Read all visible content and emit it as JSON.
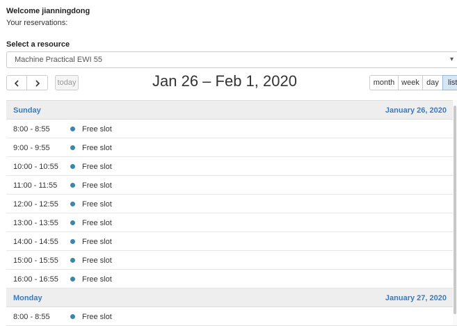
{
  "header": {
    "welcome": "Welcome jianningdong",
    "reservations_label": "Your reservations:"
  },
  "resource": {
    "label": "Select a resource",
    "selected": "Machine Practical EWI 55",
    "caret_icon": "chevron-down-icon"
  },
  "toolbar": {
    "prev_icon": "chevron-left-icon",
    "next_icon": "chevron-right-icon",
    "today": "today",
    "title": "Jan 26 – Feb 1, 2020",
    "views": [
      "month",
      "week",
      "day",
      "list"
    ],
    "active_view": "list"
  },
  "days": [
    {
      "name": "Sunday",
      "date": "January 26, 2020",
      "slots": [
        {
          "time": "8:00 - 8:55",
          "title": "Free slot"
        },
        {
          "time": "9:00 - 9:55",
          "title": "Free slot"
        },
        {
          "time": "10:00 - 10:55",
          "title": "Free slot"
        },
        {
          "time": "11:00 - 11:55",
          "title": "Free slot"
        },
        {
          "time": "12:00 - 12:55",
          "title": "Free slot"
        },
        {
          "time": "13:00 - 13:55",
          "title": "Free slot"
        },
        {
          "time": "14:00 - 14:55",
          "title": "Free slot"
        },
        {
          "time": "15:00 - 15:55",
          "title": "Free slot"
        },
        {
          "time": "16:00 - 16:55",
          "title": "Free slot"
        }
      ]
    },
    {
      "name": "Monday",
      "date": "January 27, 2020",
      "slots": [
        {
          "time": "8:00 - 8:55",
          "title": "Free slot"
        }
      ]
    }
  ],
  "colors": {
    "event_dot": "#3a87ad",
    "day_header_text": "#3a7bbd",
    "active_view_bg": "#d6e6f5"
  }
}
